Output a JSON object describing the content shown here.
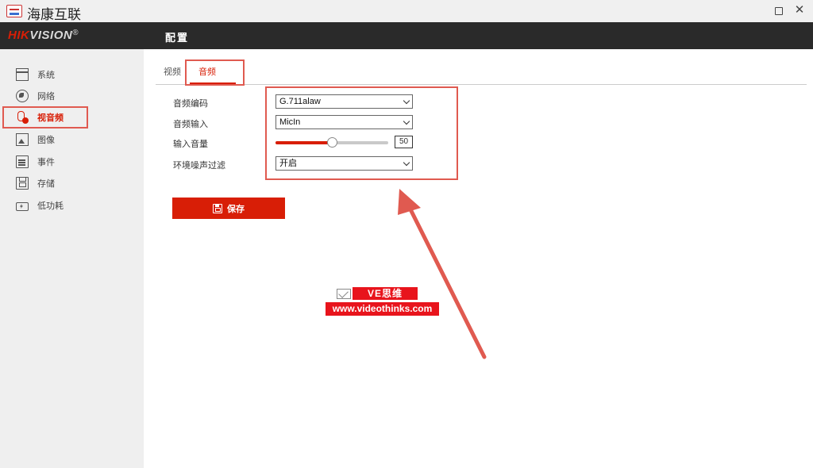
{
  "window": {
    "title": "海康互联",
    "maximize_icon": "maximize-icon",
    "close_label": "✕"
  },
  "header": {
    "brand_hik": "HIK",
    "brand_vision": "VISION",
    "brand_reg": "®",
    "title": "配置"
  },
  "sidebar": {
    "items": [
      {
        "label": "系统",
        "icon": "system-icon"
      },
      {
        "label": "网络",
        "icon": "network-icon"
      },
      {
        "label": "视音频",
        "icon": "microphone-icon"
      },
      {
        "label": "图像",
        "icon": "image-icon"
      },
      {
        "label": "事件",
        "icon": "event-icon"
      },
      {
        "label": "存储",
        "icon": "storage-icon"
      },
      {
        "label": "低功耗",
        "icon": "battery-icon"
      }
    ],
    "active_index": 2
  },
  "tabs": [
    {
      "label": "视频"
    },
    {
      "label": "音频"
    }
  ],
  "form": {
    "audio_encoding": {
      "label": "音频编码",
      "value": "G.711alaw"
    },
    "audio_input": {
      "label": "音频输入",
      "value": "MicIn"
    },
    "input_volume": {
      "label": "输入音量",
      "value": "50",
      "level_percent": 50
    },
    "noise_filter": {
      "label": "环境噪声过滤",
      "value": "开启"
    }
  },
  "save_button": {
    "label": "保存"
  },
  "watermark": {
    "name": "VE思维",
    "url": "www.videothinks.com"
  },
  "colors": {
    "accent": "#d81e06",
    "highlight": "#e05a50",
    "header_bg": "#2a2a2a"
  }
}
